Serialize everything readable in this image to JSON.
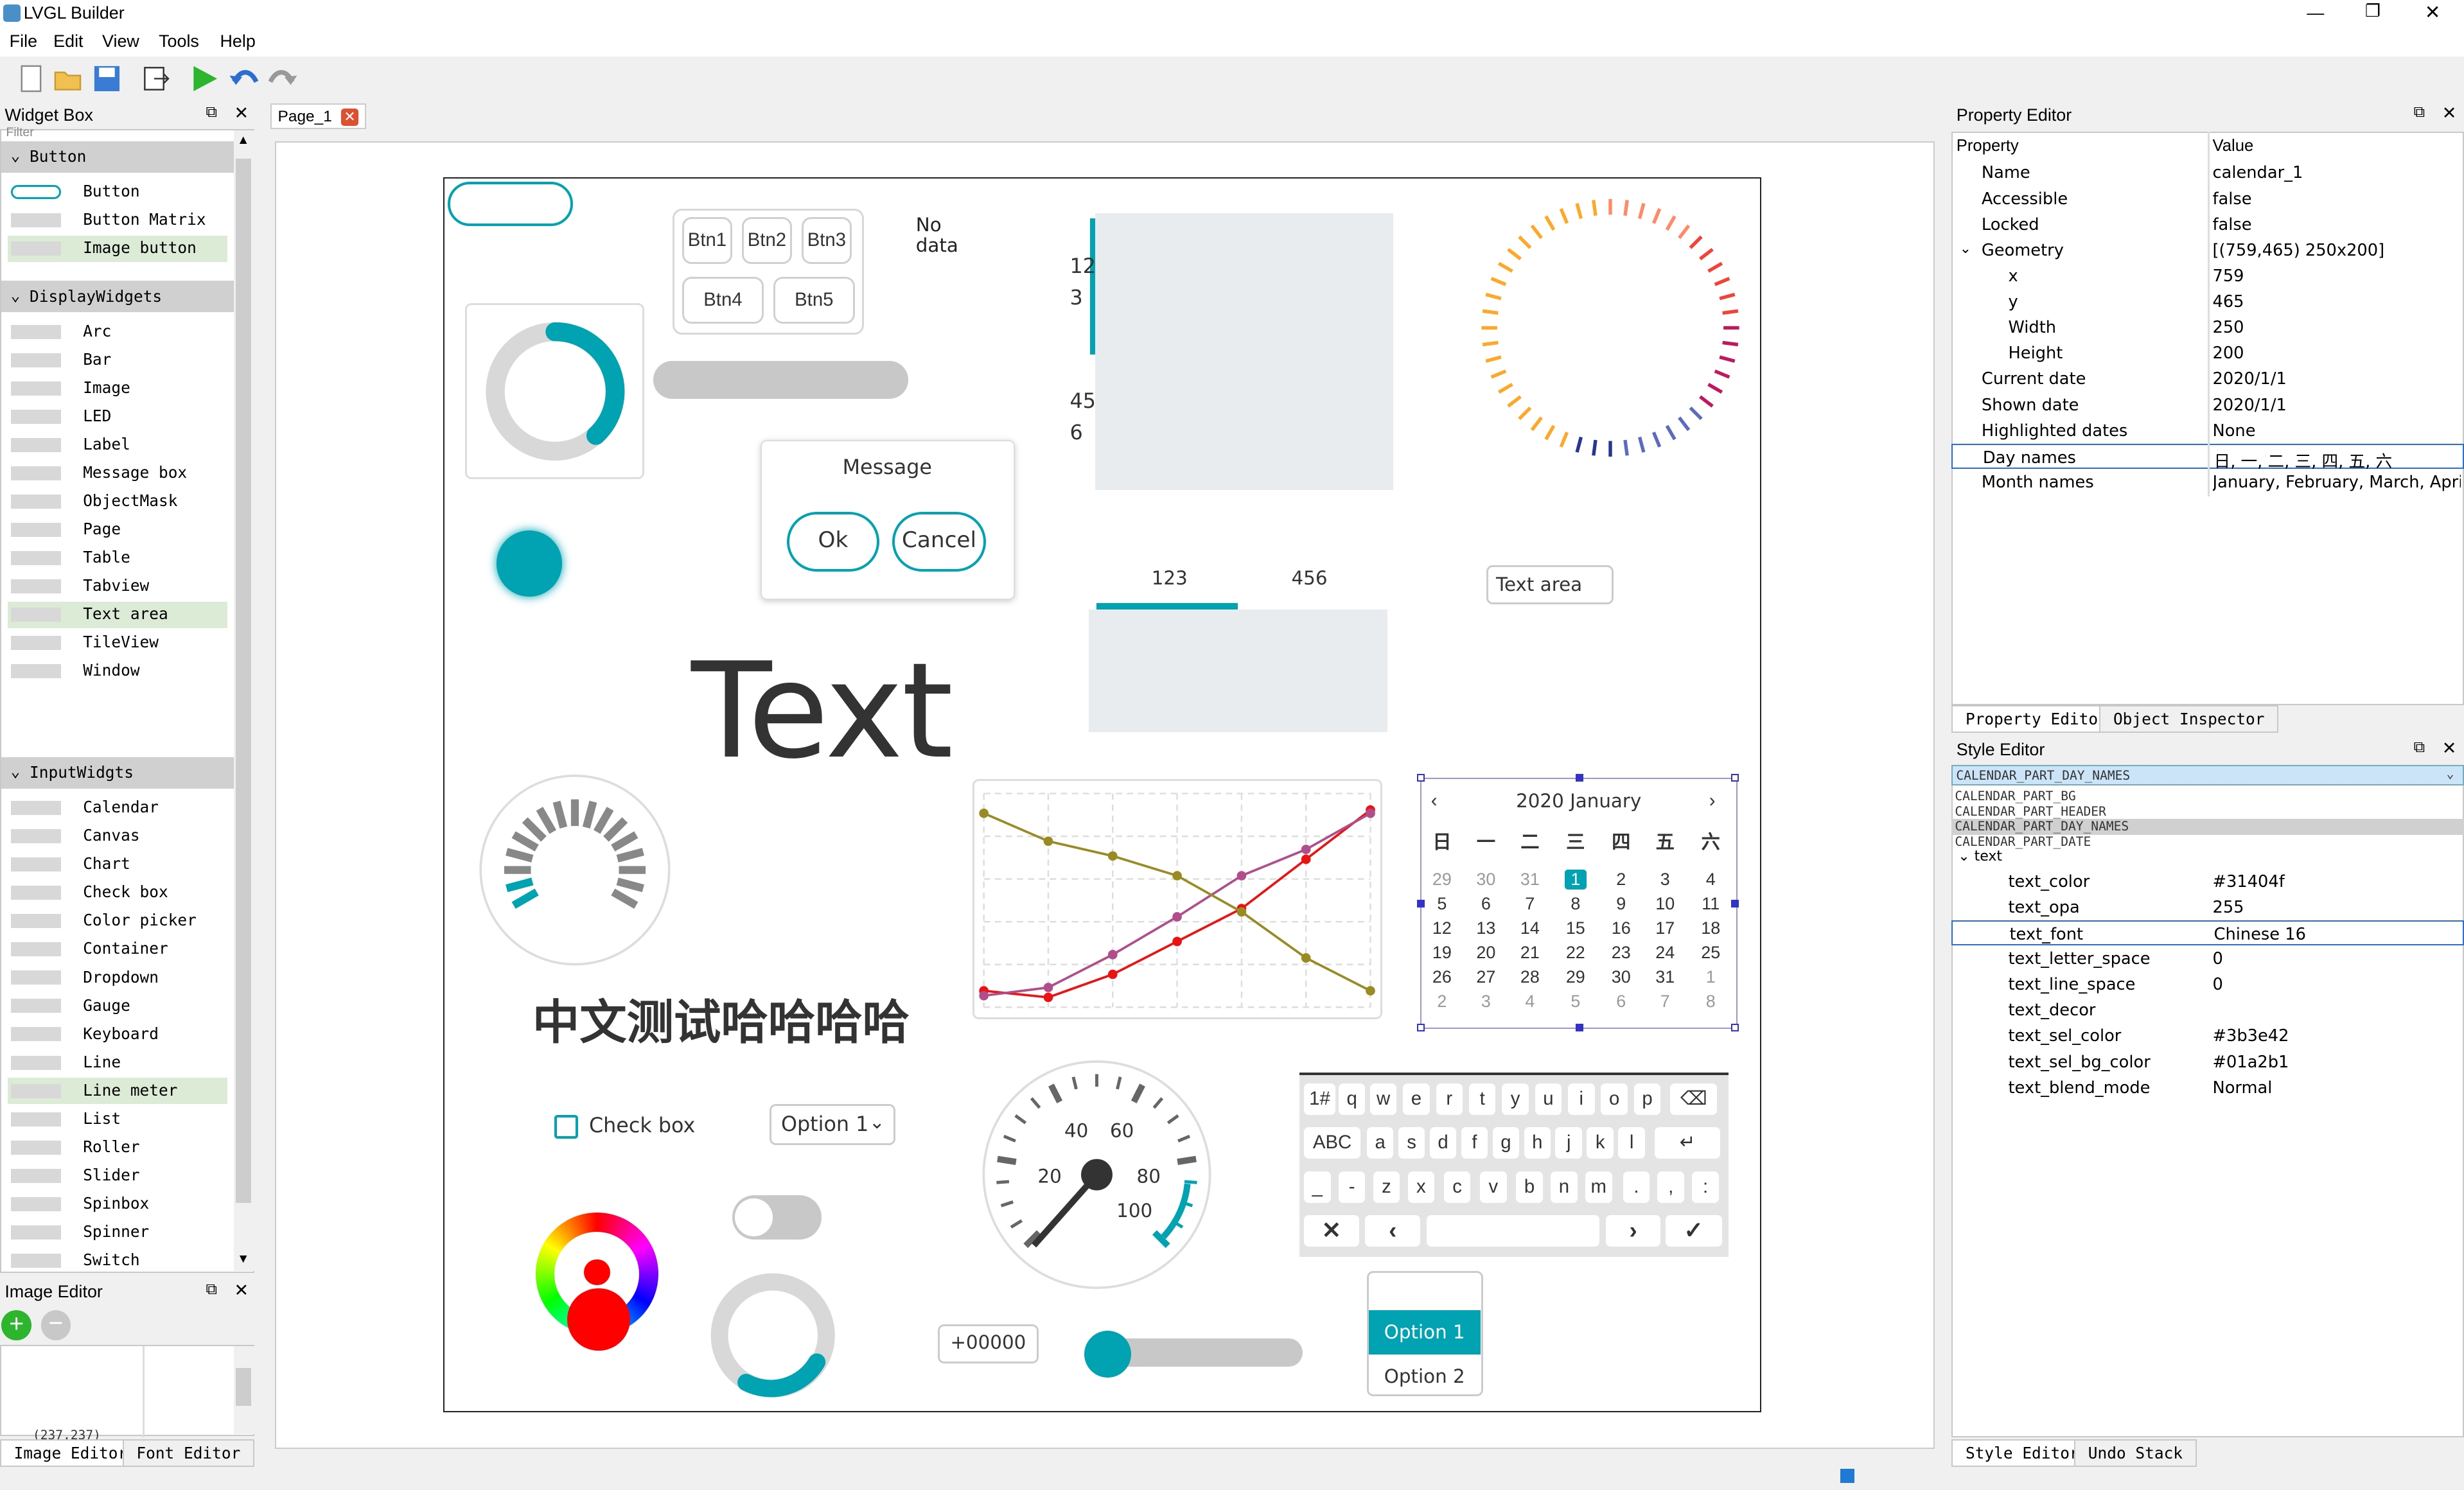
{
  "app": {
    "title": "LVGL Builder",
    "window_controls": [
      "minimize-icon",
      "restore-icon",
      "close-icon"
    ]
  },
  "menu": [
    "File",
    "Edit",
    "View",
    "Tools",
    "Help"
  ],
  "toolbar": [
    "new-file-icon",
    "open-folder-icon",
    "save-icon",
    "export-icon",
    "run-icon",
    "undo-icon",
    "redo-icon"
  ],
  "widget_box": {
    "title": "Widget Box",
    "filter": "Filter",
    "categories": [
      {
        "name": "Button",
        "items": [
          "Button",
          "Button Matrix",
          "Image button"
        ]
      },
      {
        "name": "DisplayWidgets",
        "items": [
          "Arc",
          "Bar",
          "Image",
          "LED",
          "Label",
          "Message box",
          "ObjectMask",
          "Page",
          "Table",
          "Tabview",
          "Text area",
          "TileView",
          "Window"
        ]
      },
      {
        "name": "InputWidgts",
        "items": [
          "Calendar",
          "Canvas",
          "Chart",
          "Check box",
          "Color picker",
          "Container",
          "Dropdown",
          "Gauge",
          "Keyboard",
          "Line",
          "Line meter",
          "List",
          "Roller",
          "Slider",
          "Spinbox",
          "Spinner",
          "Switch"
        ]
      }
    ]
  },
  "image_editor": {
    "title": "Image Editor",
    "status_text": "(237,237)",
    "tabs": [
      "Image Editor",
      "Font Editor"
    ]
  },
  "editor": {
    "tab": "Page_1"
  },
  "canvas": {
    "btnm": [
      "Btn1",
      "Btn2",
      "Btn3",
      "Btn4",
      "Btn5"
    ],
    "no_data": "No\ndata",
    "msgbox": {
      "title": "Message",
      "ok": "Ok",
      "cancel": "Cancel"
    },
    "roller_vals": [
      "12",
      "3",
      "45",
      "6"
    ],
    "tabs": [
      "123",
      "456"
    ],
    "textarea": "Text area",
    "big_label": "Text",
    "chinese": "中文测试哈哈哈哈",
    "checkbox": "Check box",
    "dropdown": "Option 1",
    "spinbox": "+00000",
    "list": [
      "Option 1",
      "Option 2"
    ],
    "gauge_labels": [
      "20",
      "40",
      "60",
      "80",
      "100"
    ],
    "calendar": {
      "header": "2020 January",
      "days": [
        "日",
        "一",
        "二",
        "三",
        "四",
        "五",
        "六"
      ],
      "dates": [
        [
          "29",
          "30",
          "31",
          "1",
          "2",
          "3",
          "4"
        ],
        [
          "5",
          "6",
          "7",
          "8",
          "9",
          "10",
          "11"
        ],
        [
          "12",
          "13",
          "14",
          "15",
          "16",
          "17",
          "18"
        ],
        [
          "19",
          "20",
          "21",
          "22",
          "23",
          "24",
          "25"
        ],
        [
          "26",
          "27",
          "28",
          "29",
          "30",
          "31",
          "1"
        ],
        [
          "2",
          "3",
          "4",
          "5",
          "6",
          "7",
          "8"
        ]
      ],
      "highlight": "1"
    },
    "keyboard": {
      "rows": [
        [
          "1#",
          "q",
          "w",
          "e",
          "r",
          "t",
          "y",
          "u",
          "i",
          "o",
          "p",
          "⌫"
        ],
        [
          "ABC",
          "a",
          "s",
          "d",
          "f",
          "g",
          "h",
          "j",
          "k",
          "l",
          "↵"
        ],
        [
          "_",
          "-",
          "z",
          "x",
          "c",
          "v",
          "b",
          "n",
          "m",
          ".",
          ",",
          ":"
        ],
        [
          "✕",
          "‹",
          "",
          "›",
          "✓"
        ]
      ]
    }
  },
  "property_editor": {
    "title": "Property Editor",
    "header_property": "Property",
    "header_value": "Value",
    "rows": [
      {
        "k": "Name",
        "v": "calendar_1",
        "i": 0
      },
      {
        "k": "Accessible",
        "v": "false",
        "i": 0
      },
      {
        "k": "Locked",
        "v": "false",
        "i": 0
      },
      {
        "k": "Geometry",
        "v": "[(759,465) 250x200]",
        "i": 0,
        "exp": true
      },
      {
        "k": "x",
        "v": "759",
        "i": 1
      },
      {
        "k": "y",
        "v": "465",
        "i": 1
      },
      {
        "k": "Width",
        "v": "250",
        "i": 1
      },
      {
        "k": "Height",
        "v": "200",
        "i": 1
      },
      {
        "k": "Current date",
        "v": "2020/1/1",
        "i": 0
      },
      {
        "k": "Shown date",
        "v": "2020/1/1",
        "i": 0
      },
      {
        "k": "Highlighted dates",
        "v": "None",
        "i": 0
      },
      {
        "k": "Day names",
        "v": "日, 一, 二, 三, 四, 五, 六",
        "i": 0,
        "sel": true
      },
      {
        "k": "Month names",
        "v": "January, February, March, April,...",
        "i": 0
      }
    ],
    "tabs": [
      "Property Editor",
      "Object Inspector"
    ]
  },
  "style_editor": {
    "title": "Style Editor",
    "selected_part": "CALENDAR_PART_DAY_NAMES",
    "parts": [
      "CALENDAR_PART_BG",
      "CALENDAR_PART_HEADER",
      "CALENDAR_PART_DAY_NAMES",
      "CALENDAR_PART_DATE"
    ],
    "group": "text",
    "rows": [
      {
        "k": "text_color",
        "v": "#31404f"
      },
      {
        "k": "text_opa",
        "v": "255"
      },
      {
        "k": "text_font",
        "v": "Chinese 16",
        "sel": true
      },
      {
        "k": "text_letter_space",
        "v": "0"
      },
      {
        "k": "text_line_space",
        "v": "0"
      },
      {
        "k": "text_decor",
        "v": ""
      },
      {
        "k": "text_sel_color",
        "v": "#3b3e42"
      },
      {
        "k": "text_sel_bg_color",
        "v": "#01a2b1"
      },
      {
        "k": "text_blend_mode",
        "v": "Normal"
      }
    ],
    "tabs": [
      "Style Editor",
      "Undo Stack"
    ]
  },
  "colors": {
    "accent": "#01a2b1",
    "text": "#31404f"
  },
  "chart_data": {
    "type": "line",
    "series": [
      {
        "name": "",
        "values": [
          10,
          6,
          20,
          40,
          60,
          90,
          120
        ]
      },
      {
        "name": "",
        "values": [
          7,
          12,
          32,
          55,
          80,
          96,
          118
        ]
      },
      {
        "name": "",
        "values": [
          118,
          101,
          92,
          80,
          58,
          30,
          10
        ]
      }
    ]
  }
}
